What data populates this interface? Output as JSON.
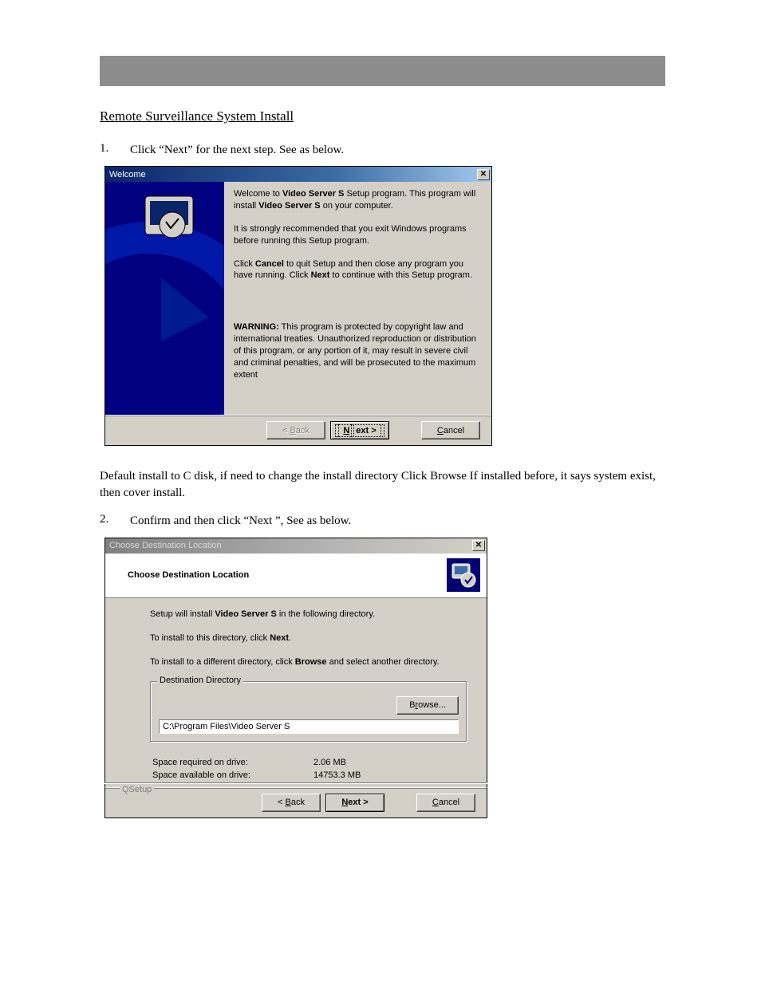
{
  "doc": {
    "section_title": "Remote Surveillance System Install",
    "step1_num": "1.",
    "step1_text_a": "Click “Next”",
    "step1_text_b": " for the next step. See as below.",
    "mid_para_a": "Default install to C disk, if need to change the install directory Click Browse If installed before, it says system exist, then cover install.",
    "step2_num": "2.",
    "step2_text_a": "Confirm and then click “Next ”",
    "step2_text_b": ", See as below."
  },
  "welcome": {
    "title": "Welcome",
    "p1_a": "Welcome to ",
    "p1_b": "Video Server S",
    "p1_c": " Setup program. This program will install ",
    "p1_d": "Video Server S",
    "p1_e": " on your computer.",
    "p2": "It is strongly recommended that you exit Windows programs before running this Setup program.",
    "p3_a": "Click ",
    "p3_b": "Cancel",
    "p3_c": " to quit Setup and then close any program you have running. Click ",
    "p3_d": "Next",
    "p3_e": " to continue with this Setup program.",
    "warn_label": "WARNING:",
    "warn_text": " This program is protected by copyright law and international treaties. Unauthorized reproduction or distribution of this program, or any portion of it, may result in severe civil and criminal penalties, and will be prosecuted to the maximum extent",
    "btn_back_prefix": "< ",
    "btn_back_u": "B",
    "btn_back_rest": "ack",
    "btn_next_u": "N",
    "btn_next_rest": "ext >",
    "btn_cancel_u": "C",
    "btn_cancel_rest": "ancel"
  },
  "dest": {
    "title": "Choose Destination Location",
    "header_title": "Choose Destination Location",
    "p1_a": "Setup will install ",
    "p1_b": "Video Server S",
    "p1_c": " in the following directory.",
    "p2_a": "To install to this directory, click ",
    "p2_b": "Next",
    "p2_c": ".",
    "p3_a": "To install to a different directory, click ",
    "p3_b": "Browse",
    "p3_c": " and select another directory.",
    "group_legend": "Destination Directory",
    "browse_u": "r",
    "browse_pre": "B",
    "browse_post": "owse...",
    "path": "C:\\Program Files\\Video Server S",
    "space_req_label": "Space required on drive:",
    "space_req_val": "2.06 MB",
    "space_avail_label": "Space available on drive:",
    "space_avail_val": "14753.3 MB",
    "qsetup": "QSetup",
    "btn_back_prefix": "< ",
    "btn_back_u": "B",
    "btn_back_rest": "ack",
    "btn_next_u": "N",
    "btn_next_rest": "ext >",
    "btn_cancel_u": "C",
    "btn_cancel_rest": "ancel"
  }
}
